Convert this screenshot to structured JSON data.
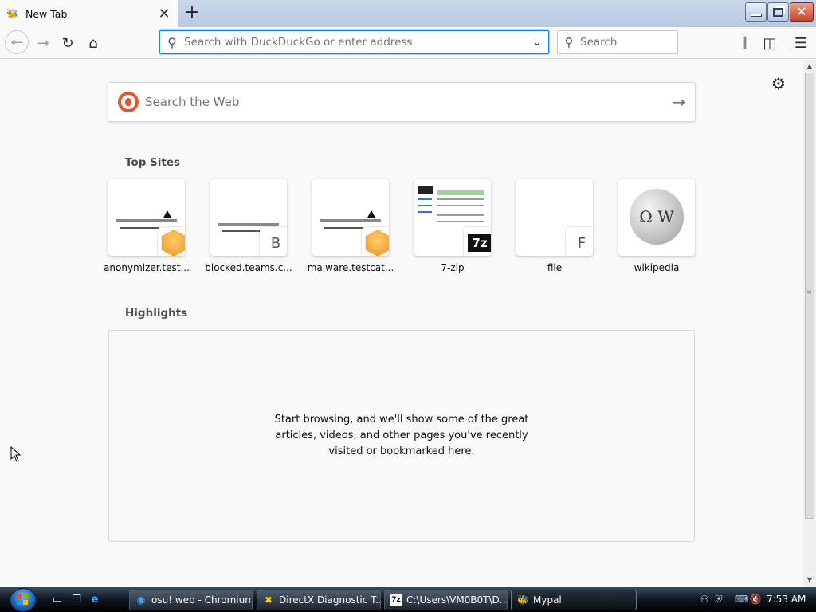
{
  "browser": {
    "tab": {
      "title": "New Tab"
    },
    "urlbar": {
      "placeholder": "Search with DuckDuckGo or enter address"
    },
    "searchbar": {
      "placeholder": "Search"
    }
  },
  "newtab": {
    "websearch": {
      "placeholder": "Search the Web"
    },
    "top_sites": {
      "title": "Top Sites",
      "tiles": [
        {
          "label": "anonymizer.test...",
          "badge": ""
        },
        {
          "label": "blocked.teams.c...",
          "badge": "B"
        },
        {
          "label": "malware.testcat...",
          "badge": ""
        },
        {
          "label": "7-zip",
          "badge": ""
        },
        {
          "label": "file",
          "badge": "F"
        },
        {
          "label": "wikipedia",
          "badge": ""
        }
      ]
    },
    "highlights": {
      "title": "Highlights",
      "empty_message": "Start browsing, and we'll show some of the great articles, videos, and other pages you've recently visited or bookmarked here."
    }
  },
  "taskbar": {
    "tasks": [
      {
        "label": "osu! web - Chromium"
      },
      {
        "label": "DirectX Diagnostic T..."
      },
      {
        "label": "C:\\Users\\VM0B0T\\D..."
      },
      {
        "label": "Mypal"
      }
    ],
    "clock": "7:53 AM"
  }
}
